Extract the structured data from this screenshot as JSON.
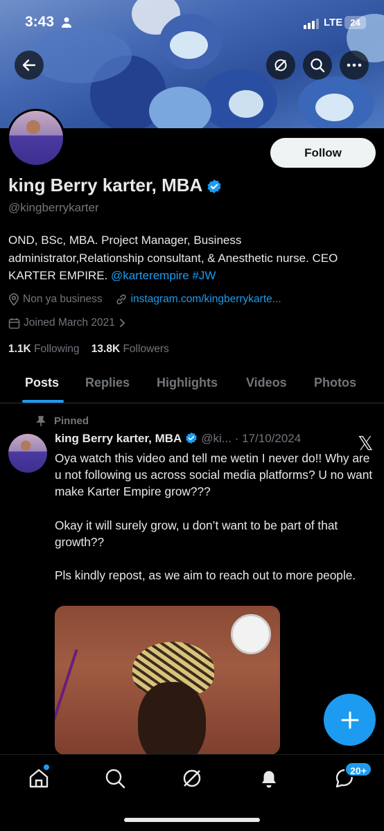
{
  "status_bar": {
    "time": "3:43",
    "network": "LTE",
    "battery": "24"
  },
  "header": {
    "back_icon": "arrow-left-icon",
    "grok_icon": "grok-icon",
    "search_icon": "search-icon",
    "more_icon": "more-icon"
  },
  "profile": {
    "display_name": "king Berry karter, MBA",
    "handle": "@kingberrykarter",
    "follow_label": "Follow",
    "bio_text": "OND, BSc, MBA. Project Manager, Business administrator,Relationship consultant, & Anesthetic nurse. CEO KARTER EMPIRE. ",
    "bio_mention": "@karterempire",
    "bio_hashtag": "#JW",
    "location": "Non ya business",
    "website": "instagram.com/kingberrykarte...",
    "joined": "Joined March 2021",
    "following_count": "1.1K",
    "following_label": "Following",
    "followers_count": "13.8K",
    "followers_label": "Followers"
  },
  "tabs": [
    "Posts",
    "Replies",
    "Highlights",
    "Videos",
    "Photos"
  ],
  "tweet": {
    "pinned_label": "Pinned",
    "name": "king Berry karter, MBA",
    "handle_date": "@ki... · 17/10/2024",
    "para1": "Oya watch this video and tell me wetin I never do!! Why are u not following us across social media platforms? U no want make Karter Empire grow???",
    "para2": "Okay it will surely grow, u don’t want to be part of that growth??",
    "para3": "Pls kindly repost, as we aim to reach out to more people."
  },
  "bottom_nav": {
    "notification_badge": "20+"
  },
  "colors": {
    "accent": "#1d9bf0",
    "background": "#000000",
    "secondary_text": "#71767b"
  }
}
